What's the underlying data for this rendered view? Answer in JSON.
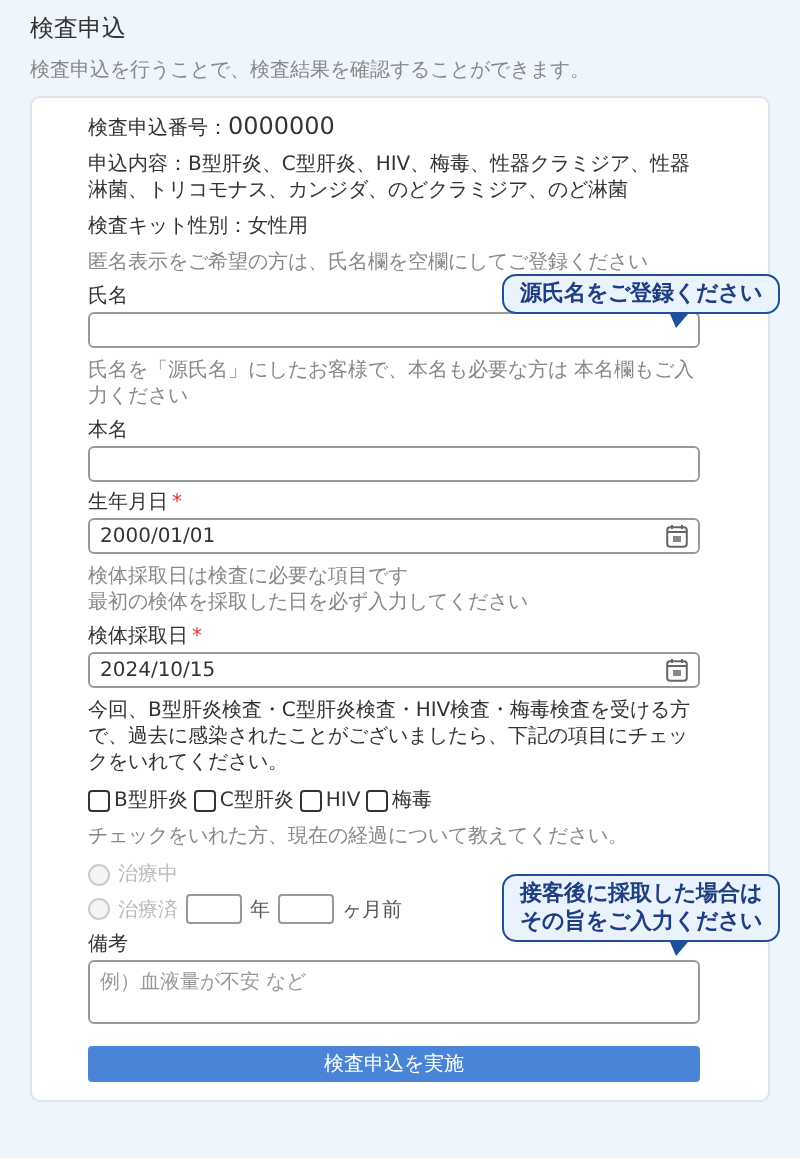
{
  "title": "検査申込",
  "subtitle": "検査申込を行うことで、検査結果を確認することができます。",
  "application_number": {
    "label": "検査申込番号：",
    "value": "0000000"
  },
  "contents": "申込内容：B型肝炎、C型肝炎、HIV、梅毒、性器クラミジア、性器淋菌、トリコモナス、カンジダ、のどクラミジア、のど淋菌",
  "kit": "検査キット性別：女性用",
  "form": [
    {
      "kind": "note",
      "lines": [
        "匿名表示をご希望の方は、氏名欄を空欄にしてご登録ください"
      ]
    },
    {
      "kind": "input",
      "label": "氏名",
      "callout": [
        "源氏名をご登録ください"
      ]
    },
    {
      "kind": "note",
      "lines": [
        "氏名を「源氏名」にしたお客様で、本名も必要な方は 本名欄もご入力ください"
      ]
    },
    {
      "kind": "input",
      "label": "本名"
    },
    {
      "kind": "date",
      "label": "生年月日",
      "required_mark": "*",
      "value": "2000/01/01"
    },
    {
      "kind": "note",
      "lines": [
        "検体採取日は検査に必要な項目です",
        "最初の検体を採取した日を必ず入力してください"
      ]
    },
    {
      "kind": "date",
      "label": "検体採取日",
      "required_mark": "*",
      "value": "2024/10/15"
    },
    {
      "kind": "text",
      "lines": [
        "今回、B型肝炎検査・C型肝炎検査・HIV検査・梅毒検査を受ける方で、過去に感染されたことがございましたら、下記の項目にチェックをいれてください。"
      ]
    },
    {
      "kind": "checkboxes",
      "options": [
        {
          "label": "B型肝炎",
          "checked": false
        },
        {
          "label": "C型肝炎",
          "checked": false
        },
        {
          "label": "HIV",
          "checked": false
        },
        {
          "label": "梅毒",
          "checked": false
        }
      ]
    },
    {
      "kind": "note",
      "lines": [
        "チェックをいれた方、現在の経過について教えてください。"
      ]
    },
    {
      "kind": "radios",
      "options": [
        {
          "label": "治療中",
          "selected": false,
          "disabled": true
        },
        {
          "label": "治療済",
          "selected": false,
          "disabled": true,
          "year_unit": "年",
          "month_unit": "ヶ月前"
        }
      ]
    },
    {
      "kind": "textarea",
      "label": "備考",
      "placeholder": "例）血液量が不安 など",
      "callout": [
        "接客後に採取した場合は",
        "その旨をご入力ください"
      ]
    },
    {
      "kind": "button",
      "label": "検査申込を実施"
    }
  ]
}
